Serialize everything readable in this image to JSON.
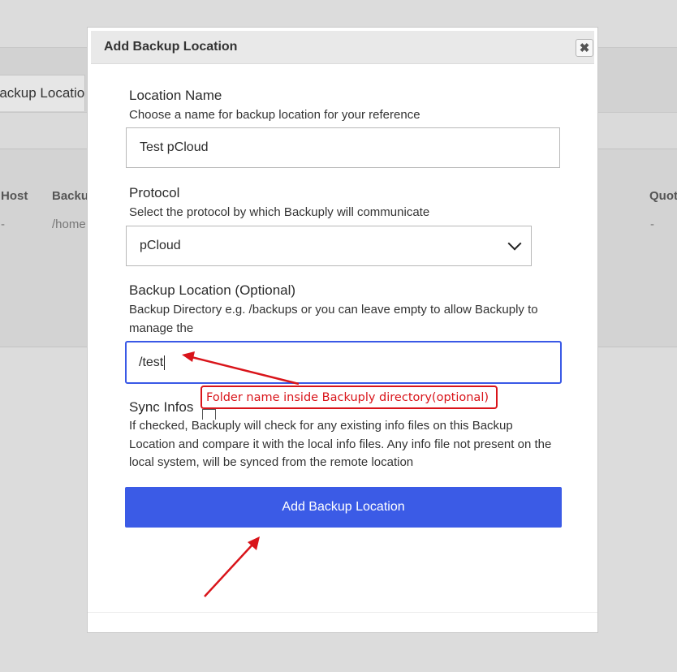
{
  "background": {
    "tab_label": "Backup Locations",
    "table_headers": {
      "host": "Host",
      "backup": "Backup",
      "quota": "Quota"
    },
    "table_row": {
      "host": "-",
      "backup": "/home",
      "quota": "-"
    }
  },
  "modal": {
    "title": "Add Backup Location",
    "close_glyph": "✖",
    "location_name": {
      "label": "Location Name",
      "help": "Choose a name for backup location for your reference",
      "value": "Test pCloud"
    },
    "protocol": {
      "label": "Protocol",
      "help": "Select the protocol by which Backuply will communicate",
      "selected": "pCloud"
    },
    "backup_location": {
      "label": "Backup Location (Optional)",
      "help": "Backup Directory e.g. /backups or you can leave empty to allow Backuply to manage the",
      "value": "/test"
    },
    "sync_infos": {
      "label": "Sync Infos",
      "checked": false,
      "help": "If checked, Backuply will check for any existing info files on this Backup Location and compare it with the local info files. Any info file not present on the local system, will be synced from the remote location"
    },
    "submit_label": "Add Backup Location"
  },
  "annotation": {
    "text": "Folder name inside Backuply directory(optional)",
    "color": "#d9141a"
  },
  "colors": {
    "accent": "#3b5be6",
    "focus_border": "#3a59e6",
    "annotation": "#d9141a"
  },
  "icons": {
    "close": "close-icon",
    "dropdown": "chevron-down-icon"
  }
}
